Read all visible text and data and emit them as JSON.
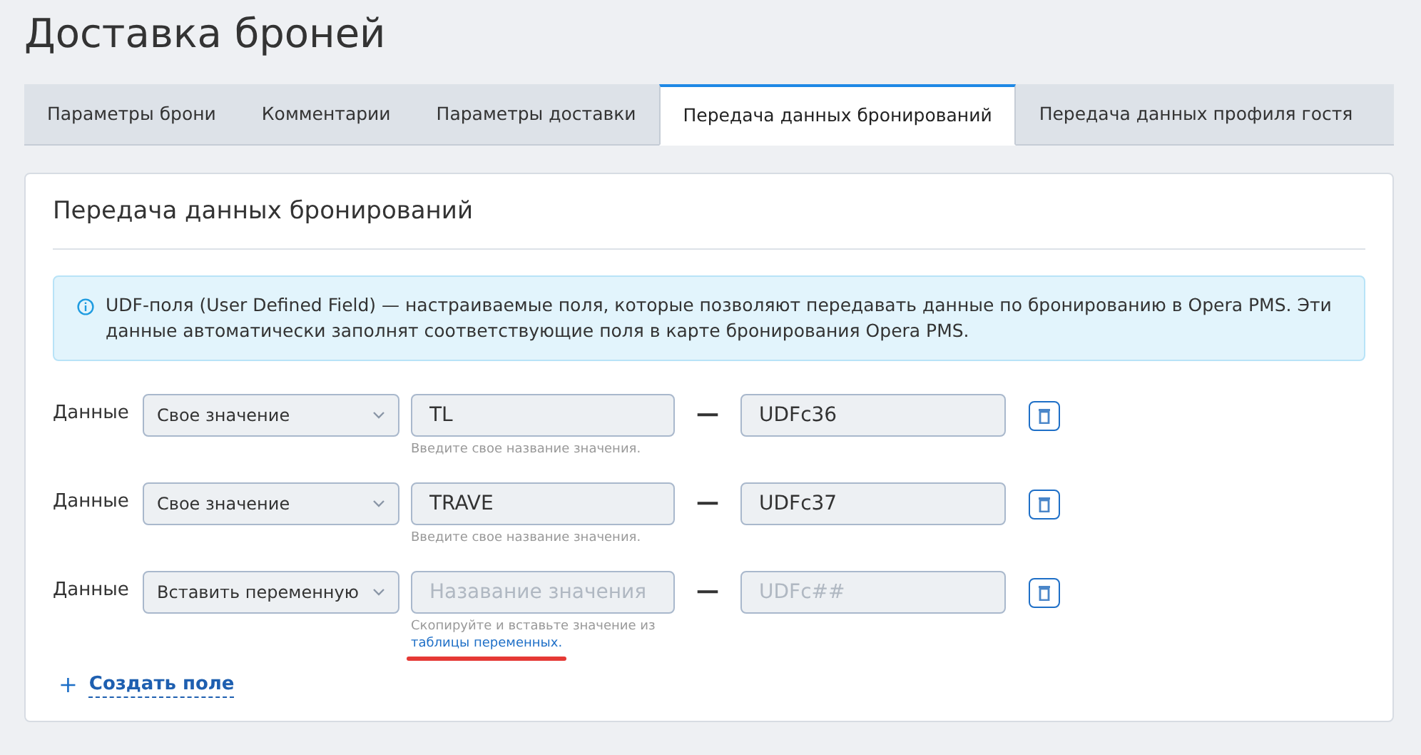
{
  "page_title": "Доставка броней",
  "tabs": [
    {
      "label": "Параметры брони",
      "selected": false
    },
    {
      "label": "Комментарии",
      "selected": false
    },
    {
      "label": "Параметры доставки",
      "selected": false
    },
    {
      "label": "Передача данных бронирований",
      "selected": true
    },
    {
      "label": "Передача данных профиля гостя",
      "selected": false
    }
  ],
  "section": {
    "title": "Передача данных бронирований",
    "info": "UDF-поля (User Defined Field) — настраиваемые поля, которые позволяют передавать данные по бронированию в Opera PMS. Эти данные автоматически заполнят соответствующие поля в карте бронирования Opera PMS.",
    "rows": [
      {
        "label": "Данные",
        "select": "Свое значение",
        "name": {
          "value": "TL"
        },
        "hint": {
          "text": "Введите свое название значения."
        },
        "separator": "—",
        "code": {
          "value": "UDFc36"
        }
      },
      {
        "label": "Данные",
        "select": "Свое значение",
        "name": {
          "value": "TRAVE"
        },
        "hint": {
          "text": "Введите свое название значения."
        },
        "separator": "—",
        "code": {
          "value": "UDFc37"
        }
      },
      {
        "label": "Данные",
        "select": "Вставить переменную",
        "name": {
          "placeholder": "Назавание значения"
        },
        "hint": {
          "text": "Скопируйте и вставьте значение из",
          "link": "таблицы переменных.",
          "highlighted": true
        },
        "separator": "—",
        "code": {
          "placeholder": "UDFc##"
        }
      }
    ],
    "add_button": {
      "icon": "+",
      "label": "Создать поле"
    }
  }
}
